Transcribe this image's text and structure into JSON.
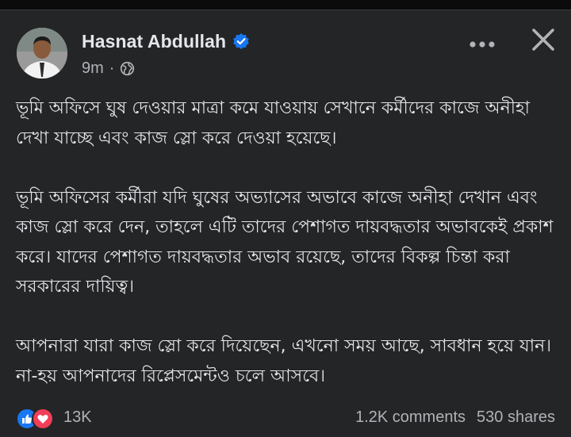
{
  "post": {
    "author": "Hasnat Abdullah",
    "verified_icon": "verified-badge-icon",
    "time": "9m",
    "separator": "·",
    "audience_icon": "globe-icon",
    "paragraphs": [
      "ভূমি অফিসে ঘুষ দেওয়ার মাত্রা কমে যাওয়ায় সেখানে কর্মীদের কাজে অনীহা দেখা যাচ্ছে এবং কাজ স্লো করে দেওয়া হয়েছে।",
      "ভূমি অফিসের কর্মীরা যদি ঘুষের অভ্যাসের অভাবে কাজে অনীহা দেখান এবং কাজ স্লো করে দেন, তাহলে এটি তাদের পেশাগত দায়বদ্ধতার অভাবকেই প্রকাশ করে। যাদের পেশাগত দায়বদ্ধতার অভাব রয়েছে, তাদের বিকল্প চিন্তা করা সরকারের দায়িত্ব।",
      "আপনারা যারা কাজ স্লো করে দিয়েছেন, এখনো সময় আছে, সাবধান হয়ে যান। না-হয় আপনাদের রিপ্লেসমেন্টও চলে আসবে।"
    ]
  },
  "header_actions": {
    "more_icon": "more-horizontal-icon",
    "close_icon": "close-icon"
  },
  "stats": {
    "reaction_icons": [
      "like-icon",
      "love-icon"
    ],
    "reactions": "13K",
    "comments": "1.2K comments",
    "shares": "530 shares"
  },
  "colors": {
    "background": "#0b0b0b",
    "card": "#242526",
    "primary_text": "#e4e6eb",
    "secondary_text": "#b0b3b8",
    "like_blue": "#1877f2",
    "love_red": "#f33e58",
    "verified_blue": "#1877f2"
  }
}
